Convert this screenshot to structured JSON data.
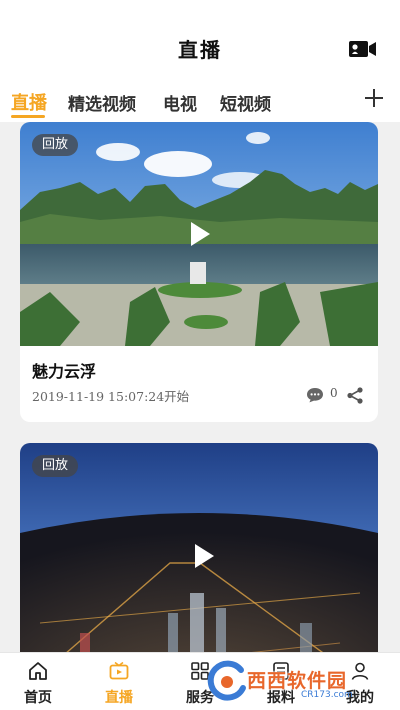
{
  "header": {
    "title": "直播",
    "camera_icon": "video-camera-icon"
  },
  "tabs": [
    {
      "label": "直播",
      "active": true
    },
    {
      "label": "精选视频",
      "active": false
    },
    {
      "label": "电视",
      "active": false
    },
    {
      "label": "短视频",
      "active": false
    }
  ],
  "add_icon": "plus-icon",
  "cards": [
    {
      "badge": "回放",
      "title": "魅力云浮",
      "time": "2019-11-19 15:07:24开始",
      "comments": "0"
    },
    {
      "badge": "回放"
    }
  ],
  "bottom_nav": [
    {
      "label": "首页",
      "icon": "home-icon",
      "active": false
    },
    {
      "label": "直播",
      "icon": "live-tv-icon",
      "active": true
    },
    {
      "label": "服务",
      "icon": "grid-icon",
      "active": false
    },
    {
      "label": "报料",
      "icon": "report-icon",
      "active": false
    },
    {
      "label": "我的",
      "icon": "user-icon",
      "active": false
    }
  ],
  "watermark": {
    "text": "西西软件园",
    "sub": "CR173.com"
  },
  "colors": {
    "accent": "#f5a623",
    "badge_bg": "#4a4a4a",
    "background": "#f0f0f0"
  }
}
